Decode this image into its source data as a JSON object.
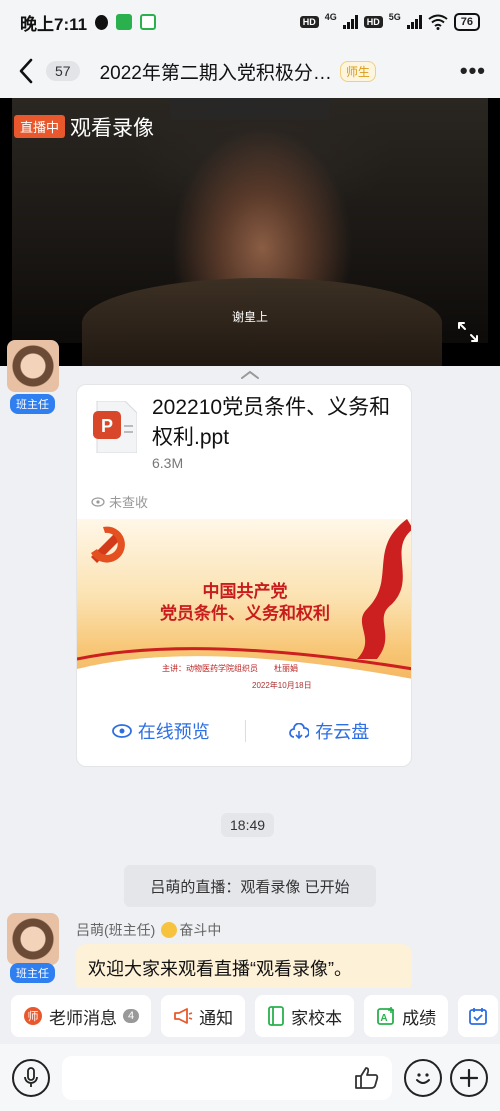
{
  "status_bar": {
    "time": "晚上7:11",
    "network1": "4G",
    "network2": "5G",
    "hd1": "HD",
    "hd2": "HD",
    "battery": "76"
  },
  "nav": {
    "unread_count": "57",
    "title": "2022年第二期入党积极分…",
    "role_tag": "师生"
  },
  "video": {
    "live_badge": "直播中",
    "title": "观看录像",
    "subtitle": "谢皇上"
  },
  "chat": {
    "first_role_chip": "班主任",
    "file": {
      "name": "202210党员条件、义务和权利.ppt",
      "size": "6.3M",
      "status": "未查收",
      "slide_title_line1": "中国共产党",
      "slide_title_line2": "党员条件、义务和权利",
      "slide_presenter": "主讲：动物医药学院组织员　　杜丽娟",
      "slide_date": "2022年10月18日",
      "preview_label": "在线预览",
      "save_label": "存云盘"
    },
    "time_divider": "18:49",
    "system_message": "吕萌的直播：观看录像 已开始",
    "sender_name": "吕萌(班主任)",
    "sender_status": "奋斗中",
    "sender_role": "班主任",
    "message_text": "欢迎大家来观看直播“观看录像”。"
  },
  "quick_bar": [
    {
      "label": "老师消息",
      "count": "4"
    },
    {
      "label": "通知"
    },
    {
      "label": "家校本"
    },
    {
      "label": "成绩"
    }
  ],
  "colors": {
    "accent_blue": "#2d6fe3",
    "live_orange": "#e9582c",
    "bubble": "#fdf1d8",
    "party_red": "#c91d1d"
  }
}
